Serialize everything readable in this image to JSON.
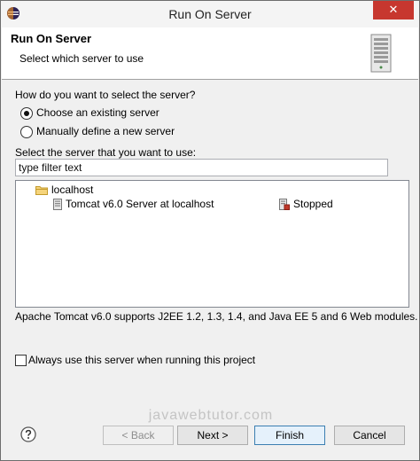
{
  "window": {
    "title": "Run On Server",
    "close_symbol": "✕",
    "app_icon": "eclipse-icon"
  },
  "banner": {
    "title": "Run On Server",
    "description": "Select which server to use",
    "graphic": "server-tower-icon"
  },
  "selection": {
    "question": "How do you want to select the server?",
    "options": [
      {
        "label": "Choose an existing server",
        "checked": true
      },
      {
        "label": "Manually define a new server",
        "checked": false
      }
    ]
  },
  "filter": {
    "label": "Select the server that you want to use:",
    "value": "type filter text"
  },
  "tree": {
    "host": "localhost",
    "server_name": "Tomcat v6.0 Server at localhost",
    "server_status": "Stopped"
  },
  "description": "Apache Tomcat v6.0 supports J2EE 1.2, 1.3, 1.4, and Java EE 5 and 6 Web modules.",
  "always_use": {
    "label": "Always use this server when running this project",
    "checked": false
  },
  "watermark": "javawebtutor.com",
  "buttons": {
    "back": "< Back",
    "next": "Next >",
    "finish": "Finish",
    "cancel": "Cancel"
  },
  "colors": {
    "close_button": "#c7372f",
    "dialog_background": "#f0f0f0",
    "default_button_border": "#3c7fb1"
  }
}
